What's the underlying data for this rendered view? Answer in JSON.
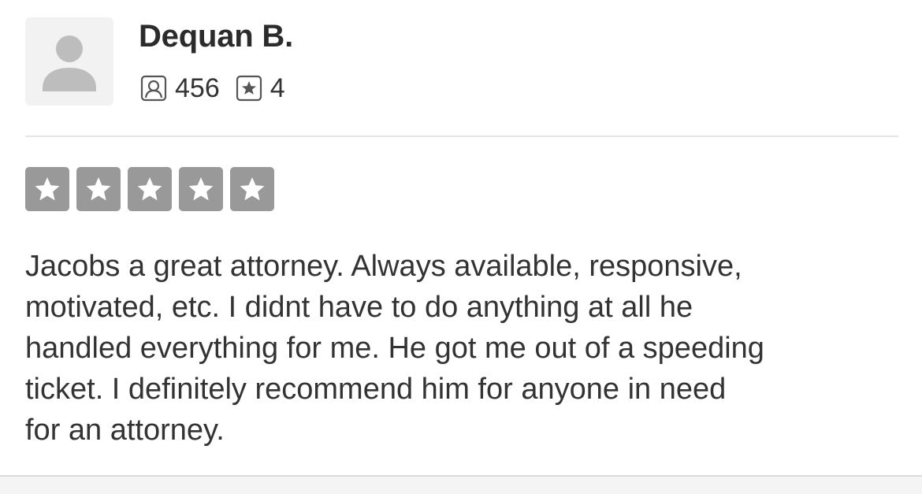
{
  "review": {
    "user": {
      "name": "Dequan B.",
      "avatar_icon": "default-user-avatar-icon",
      "friends_icon": "friends-icon",
      "friends_count": "456",
      "reviews_icon": "star-review-icon",
      "reviews_count": "4"
    },
    "rating": {
      "stars": 5,
      "max_stars": 5,
      "star_icon": "star-icon"
    },
    "text": "Jacobs a great attorney. Always available,  responsive,\nmotivated, etc. I didnt have to do anything at all he\nhandled everything for me. He got me out of a speeding\nticket.  I definitely recommend him for anyone in need\nfor an attorney."
  },
  "colors": {
    "avatar_bg": "#f2f2f2",
    "avatar_glyph": "#bdbdbd",
    "star_box": "#999999",
    "star": "#ffffff",
    "text": "#333333",
    "divider": "#e6e6e6"
  }
}
